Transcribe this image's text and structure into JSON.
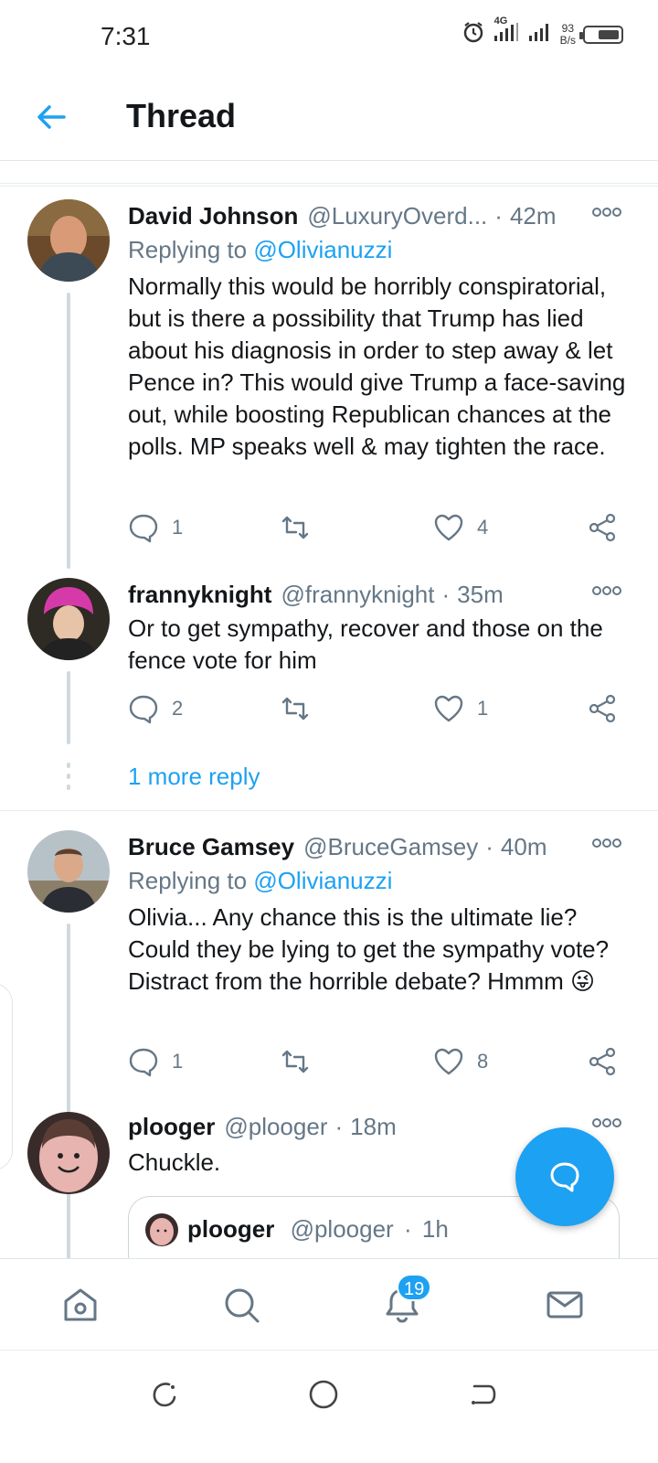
{
  "status_bar": {
    "time": "7:31",
    "network": "4G",
    "speed_value": "93",
    "speed_unit": "B/s",
    "icons": [
      "alarm-icon",
      "signal-icon",
      "signal-icon",
      "battery-icon"
    ]
  },
  "header": {
    "title": "Thread",
    "back_icon": "arrow-left-icon"
  },
  "colors": {
    "accent": "#1da1f2",
    "text": "#14171a",
    "secondary": "#657786",
    "border": "#e6ecf0"
  },
  "tweets": [
    {
      "name": "David Johnson",
      "handle": "@LuxuryOverd...",
      "separator": "·",
      "time": "42m",
      "replying_prefix": "Replying to",
      "replying_to": "@Olivianuzzi",
      "text": "Normally this would be horribly conspiratorial, but is there a possibility that Trump has lied about his diagnosis in order to step away & let Pence in? This would give Trump a face-saving out, while boosting Republican chances at the polls. MP speaks well & may tighten the race.",
      "replies": "1",
      "retweets": "",
      "likes": "4"
    },
    {
      "name": "frannyknight",
      "handle": "@frannyknight",
      "separator": "·",
      "time": "35m",
      "text": "Or to get sympathy, recover and those on the fence vote for him",
      "replies": "2",
      "retweets": "",
      "likes": "1"
    },
    {
      "name": "Bruce Gamsey",
      "handle": "@BruceGamsey",
      "separator": "·",
      "time": "40m",
      "replying_prefix": "Replying to",
      "replying_to": "@Olivianuzzi",
      "text": "Olivia... Any chance this is the ultimate lie? Could they be lying to get the sympathy vote? Distract from the horrible debate? Hmmm 😜",
      "replies": "1",
      "retweets": "",
      "likes": "8"
    },
    {
      "name": "plooger",
      "handle": "@plooger",
      "separator": "·",
      "time": "18m",
      "text": "Chuckle."
    }
  ],
  "more_replies": "1 more reply",
  "quote": {
    "name": "plooger",
    "handle": "@plooger",
    "separator": "·",
    "time": "1h"
  },
  "bottom_nav": {
    "items": [
      "home-icon",
      "search-icon",
      "notifications-icon",
      "messages-icon"
    ],
    "notification_count": "19"
  },
  "system_nav": [
    "recents-icon",
    "home-circle-icon",
    "back-icon"
  ]
}
